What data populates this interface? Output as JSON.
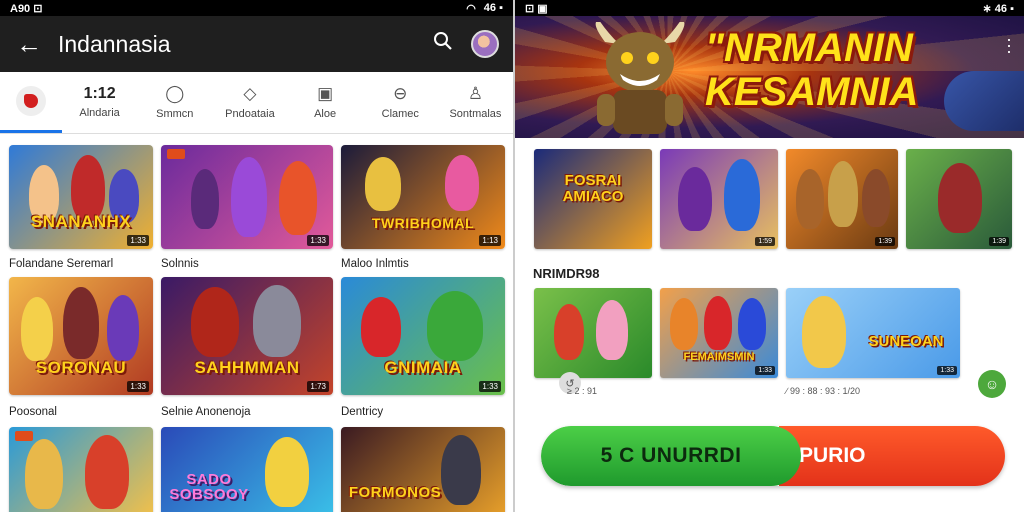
{
  "left_status": {
    "left": "A90 ⊡",
    "right": "46 ▪"
  },
  "left_appbar": {
    "title": "Indannasia",
    "back_icon": "arrow-back-icon",
    "search_icon": "search-icon"
  },
  "categories": [
    {
      "top": "1:12",
      "label": "Alndaria"
    },
    {
      "label": "Smmcn"
    },
    {
      "label": "Pndoataia"
    },
    {
      "label": "Aloe"
    },
    {
      "label": "Clamec"
    },
    {
      "label": "Sontmalas"
    }
  ],
  "left_grid": {
    "row1": [
      {
        "banner": "SNANANHX",
        "tag": "1:33",
        "bg": [
          "#2f7ad8",
          "#f0b030"
        ]
      },
      {
        "banner": "",
        "tag": "1:33",
        "bg": [
          "#6a2a9c",
          "#e25a9a"
        ]
      },
      {
        "banner": "TWRIBHOMAL",
        "tag": "1:13",
        "bg": [
          "#1b1b3a",
          "#f08a1a"
        ]
      }
    ],
    "row1_labels": [
      "Folandane Seremarl",
      "Solnnis",
      "Maloo Inlmtis"
    ],
    "row2": [
      {
        "banner": "SORONAU",
        "tag": "1:33",
        "bg": [
          "#f2b64a",
          "#b13a22"
        ]
      },
      {
        "banner": "SAHHMMAN",
        "tag": "1:73",
        "bg": [
          "#3a1a66",
          "#c4442a"
        ]
      },
      {
        "banner": "GNIMAIA",
        "tag": "1:33",
        "bg": [
          "#2a8ad8",
          "#6ac04a"
        ]
      }
    ],
    "row2_labels": [
      "Poosonal",
      "Selnie Anonenoja",
      "Dentricy"
    ],
    "row3": [
      {
        "banner": "",
        "tag": "",
        "bg": [
          "#2a9ad8",
          "#f2c04a"
        ]
      },
      {
        "banner": "SADO SOBSOOY",
        "tag": "",
        "bg": [
          "#2a4ab8",
          "#3ac0e8"
        ]
      },
      {
        "banner": "FORMONOS",
        "tag": "",
        "bg": [
          "#3a1a22",
          "#e8a02a"
        ]
      }
    ]
  },
  "right_status": {
    "left": "⊡ ▣",
    "right": "∗ 46 ▪"
  },
  "hero": {
    "title": "\"NRMANIN KESAMNIA",
    "menu_icon": "more-vert-icon"
  },
  "right_row1": [
    {
      "banner": "FOSRAI AMIACO",
      "tag": "",
      "bg": [
        "#1a2a7a",
        "#f0a020"
      ]
    },
    {
      "banner": "",
      "tag": "1:59",
      "bg": [
        "#7a3ab8",
        "#e8c060"
      ]
    },
    {
      "banner": "",
      "tag": "1:39",
      "bg": [
        "#f28a2a",
        "#6a3a12"
      ]
    },
    {
      "banner": "",
      "tag": "1:39",
      "bg": [
        "#6ab04a",
        "#2a5a3a"
      ]
    }
  ],
  "right_section": "NRIMDR98",
  "right_row2": [
    {
      "banner": "",
      "tag": "",
      "bg": [
        "#7ac04a",
        "#2a8a2a"
      ]
    },
    {
      "banner": "FEMAIMSMIN",
      "tag": "1:33",
      "bg": [
        "#f2a04a",
        "#3a8ad8"
      ]
    },
    {
      "banner": "SUNEOAN",
      "tag": "1:33",
      "bg": [
        "#9ad0f8",
        "#4a9ae8"
      ]
    }
  ],
  "right_captions": {
    "c1": "≥ 2 : 91",
    "c2": "∕ 99 : 88 : 93 : 1/20"
  },
  "cta": {
    "left": "5 C UNURRDI",
    "right": "PURIO"
  },
  "colors": {
    "accent": "#1a73e8",
    "cta_green": "#2bb13a",
    "cta_orange": "#f04a22"
  }
}
